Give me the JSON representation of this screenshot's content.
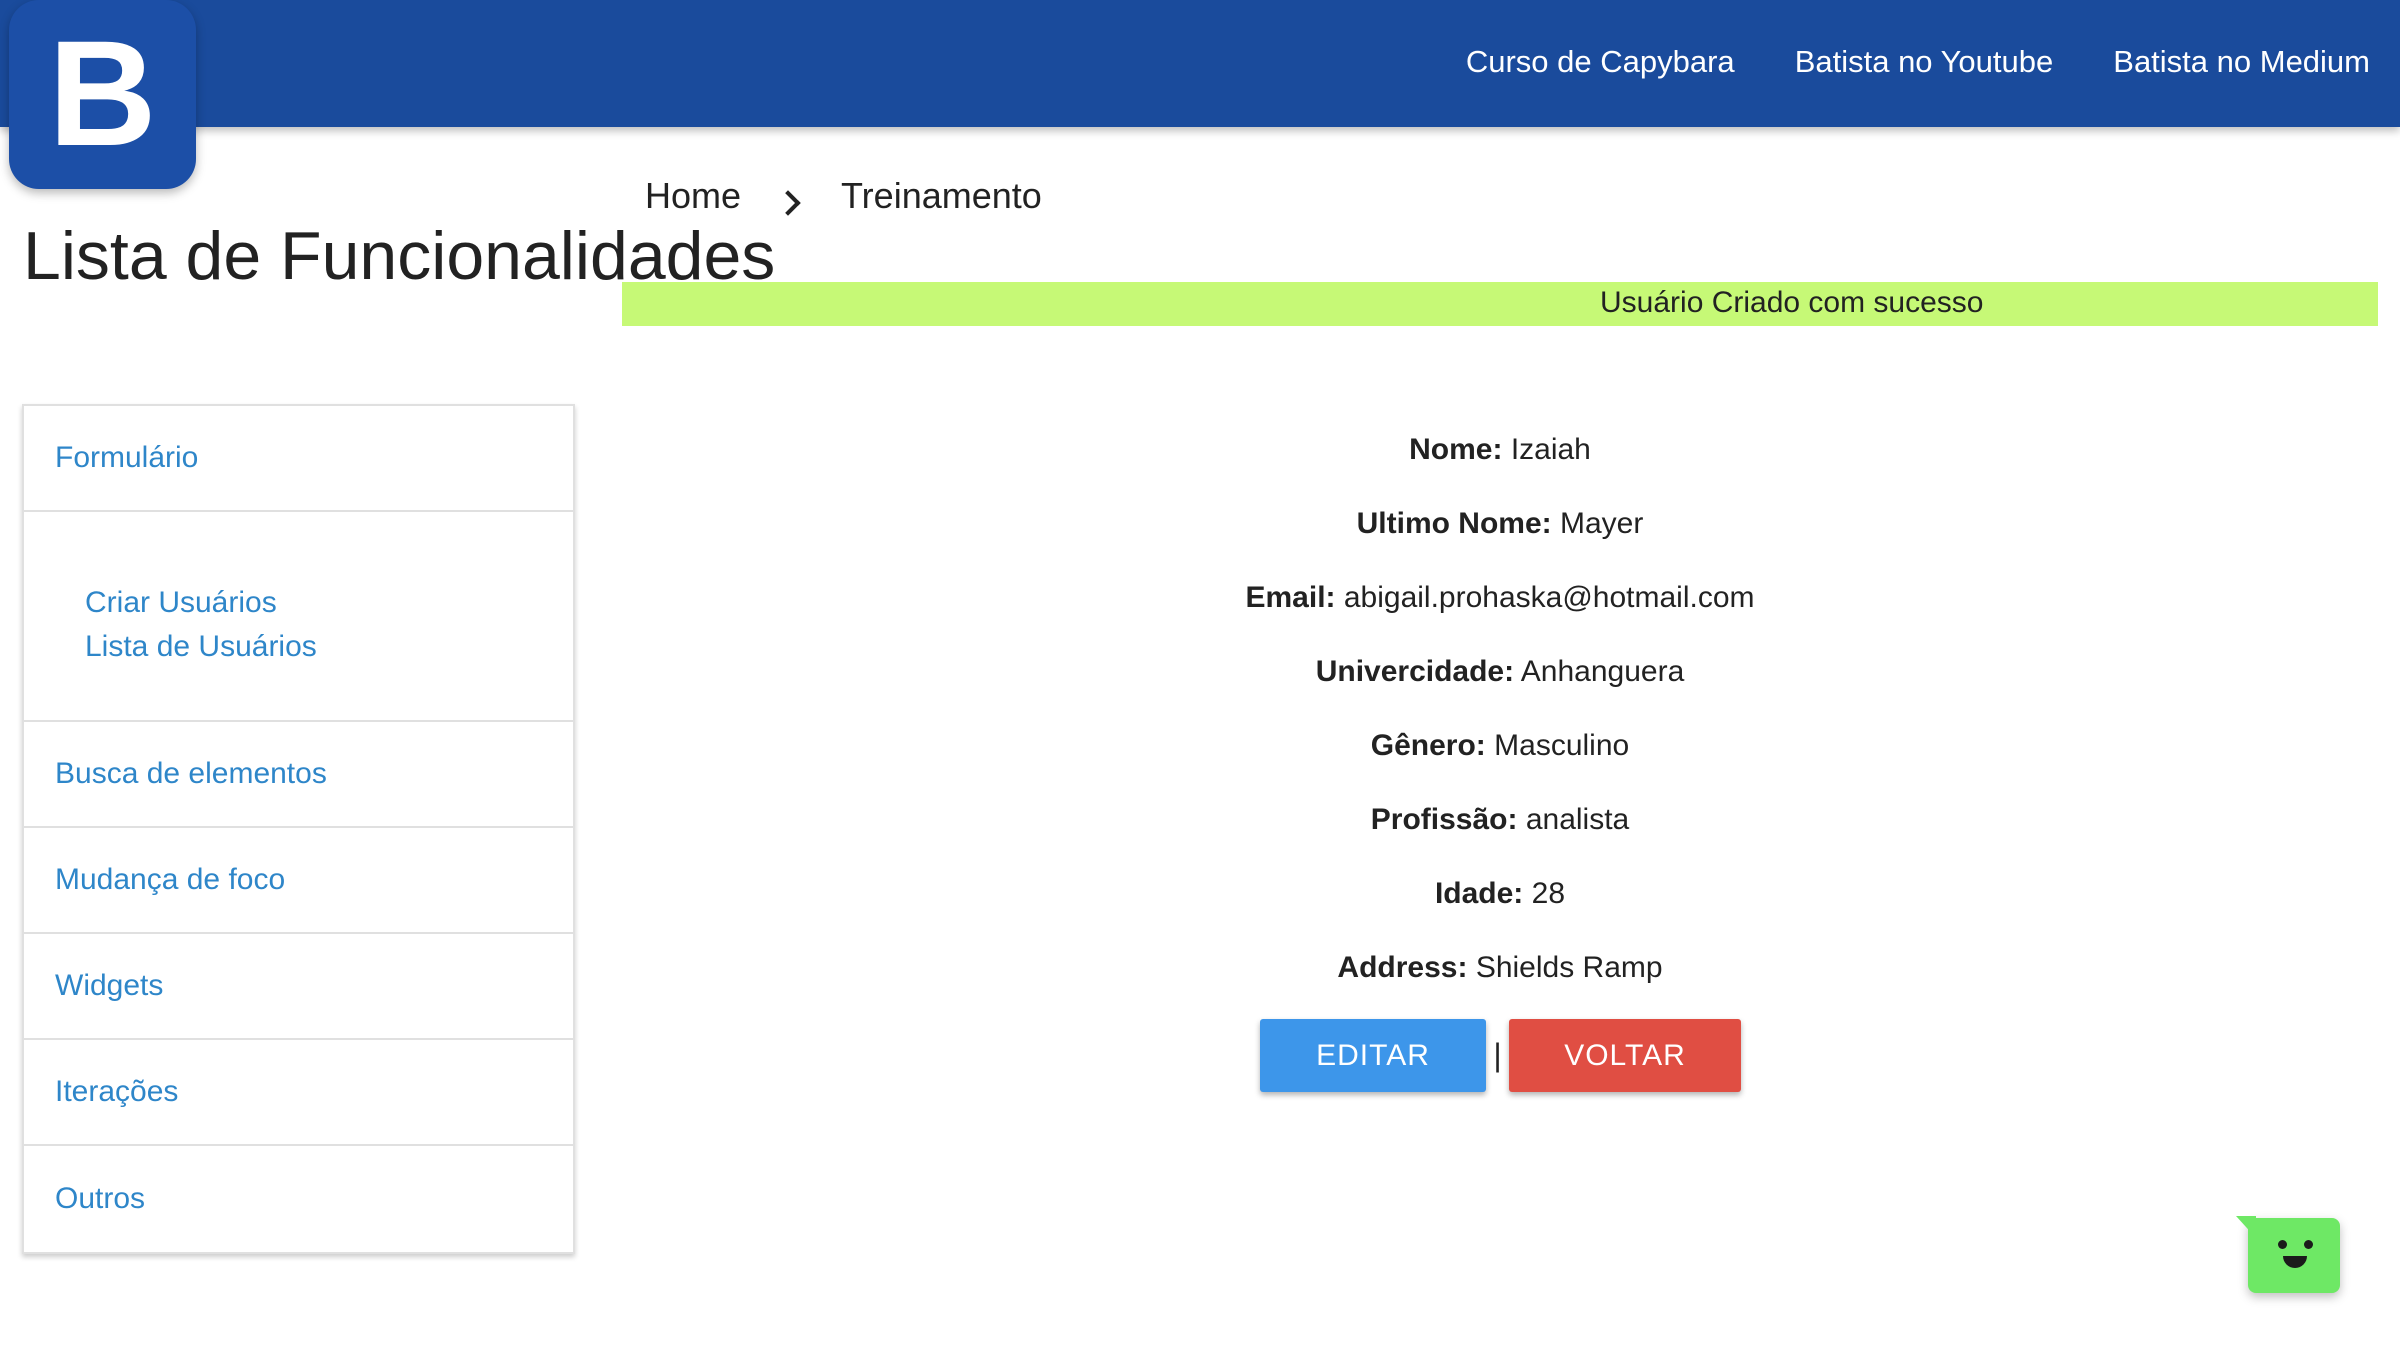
{
  "navbar": {
    "logo_letter": "B",
    "links": [
      "Curso de Capybara",
      "Batista no Youtube",
      "Batista no Medium"
    ]
  },
  "sidebar": {
    "title": "Lista de Funcionalidades",
    "items": {
      "formulario": "Formulário",
      "sub": [
        "Criar Usuários",
        "Lista de Usuários"
      ],
      "busca": "Busca de elementos",
      "foco": "Mudança de foco",
      "widgets": "Widgets",
      "iteracoes": "Iterações",
      "outros": "Outros"
    }
  },
  "breadcrumb": {
    "home": "Home",
    "current": "Treinamento"
  },
  "toast": {
    "message": "Usuário Criado com sucesso",
    "color": "#c6f976"
  },
  "user": {
    "fields": [
      {
        "label": "Nome:",
        "value": "Izaiah"
      },
      {
        "label": "Ultimo Nome:",
        "value": "Mayer"
      },
      {
        "label": "Email:",
        "value": "abigail.prohaska@hotmail.com"
      },
      {
        "label": "Univercidade:",
        "value": "Anhanguera"
      },
      {
        "label": "Gênero:",
        "value": "Masculino"
      },
      {
        "label": "Profissão:",
        "value": "analista"
      },
      {
        "label": "Idade:",
        "value": "28"
      },
      {
        "label": "Address:",
        "value": "Shields Ramp"
      }
    ]
  },
  "actions": {
    "edit_label": "EDITAR",
    "separator": "|",
    "back_label": "VOLTAR"
  },
  "colors": {
    "navbar": "#1a4b9c",
    "link": "#2e86c9",
    "edit": "#3d96ea",
    "back": "#e04e43",
    "chat": "#6ee865"
  },
  "chat_widget": {
    "icon": "smiley-chat-icon"
  }
}
